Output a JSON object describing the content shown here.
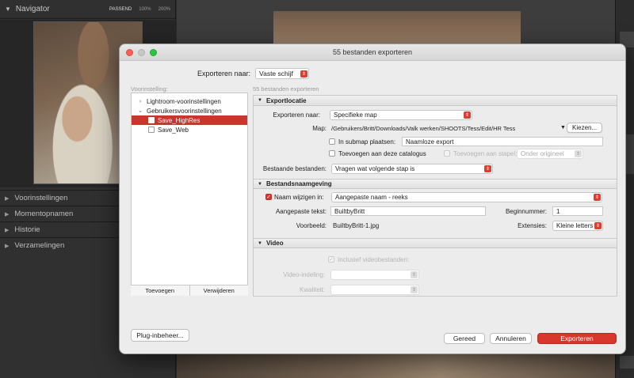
{
  "lightroom": {
    "navigator": {
      "title": "Navigator",
      "zoom_options": [
        "PASSEND",
        "100%",
        "200%"
      ],
      "selected_zoom": "PASSEND"
    },
    "panels": [
      "Voorinstellingen",
      "Momentopnamen",
      "Historie",
      "Verzamelingen"
    ]
  },
  "dialog": {
    "title": "55 bestanden exporteren",
    "export_to_label": "Exporteren naar:",
    "export_to_value": "Vaste schijf",
    "presets_label": "Voorinstelling:",
    "files_count_label": "55 bestanden exporteren",
    "preset_groups": [
      {
        "label": "Lightroom-voorinstellingen",
        "expanded": false
      },
      {
        "label": "Gebruikersvoorinstellingen",
        "expanded": true
      }
    ],
    "preset_items": [
      {
        "label": "Save_HighRes",
        "selected": true
      },
      {
        "label": "Save_Web",
        "selected": false
      }
    ],
    "preset_add": "Toevoegen",
    "preset_remove": "Verwijderen",
    "export_location": {
      "header": "Exportlocatie",
      "export_to_label": "Exporteren naar:",
      "export_to_value": "Specifieke map",
      "folder_label": "Map:",
      "folder_path": "/Gebruikers/Britt/Downloads/Valk werken/SHOOTS/Tess/Edit/HR Tess",
      "choose_button": "Kiezen...",
      "subfolder_label": "In submap plaatsen:",
      "subfolder_value": "Naamloze export",
      "add_catalog_label": "Toevoegen aan deze catalogus",
      "add_stack_label": "Toevoegen aan stapel:",
      "stack_position": "Onder origineel",
      "existing_files_label": "Bestaande bestanden:",
      "existing_files_value": "Vragen wat volgende stap is"
    },
    "file_naming": {
      "header": "Bestandsnaamgeving",
      "rename_label": "Naam wijzigen in:",
      "rename_value": "Aangepaste naam - reeks",
      "custom_text_label": "Aangepaste tekst:",
      "custom_text_value": "BuiltbyBritt",
      "start_number_label": "Beginnummer:",
      "start_number_value": "1",
      "example_label": "Voorbeeld:",
      "example_value": "BuiltbyBritt-1.jpg",
      "extensions_label": "Extensies:",
      "extensions_value": "Kleine letters"
    },
    "video": {
      "header": "Video",
      "include_video_label": "Inclusief videobestanden:",
      "video_format_label": "Video-indeling:",
      "quality_label": "Kwaliteit:"
    },
    "plugin_manager": "Plug-inbeheer...",
    "done_button": "Gereed",
    "cancel_button": "Annuleren",
    "export_button": "Exporteren"
  },
  "colors": {
    "accent": "#d8372c",
    "selected_row": "#c8362c"
  }
}
